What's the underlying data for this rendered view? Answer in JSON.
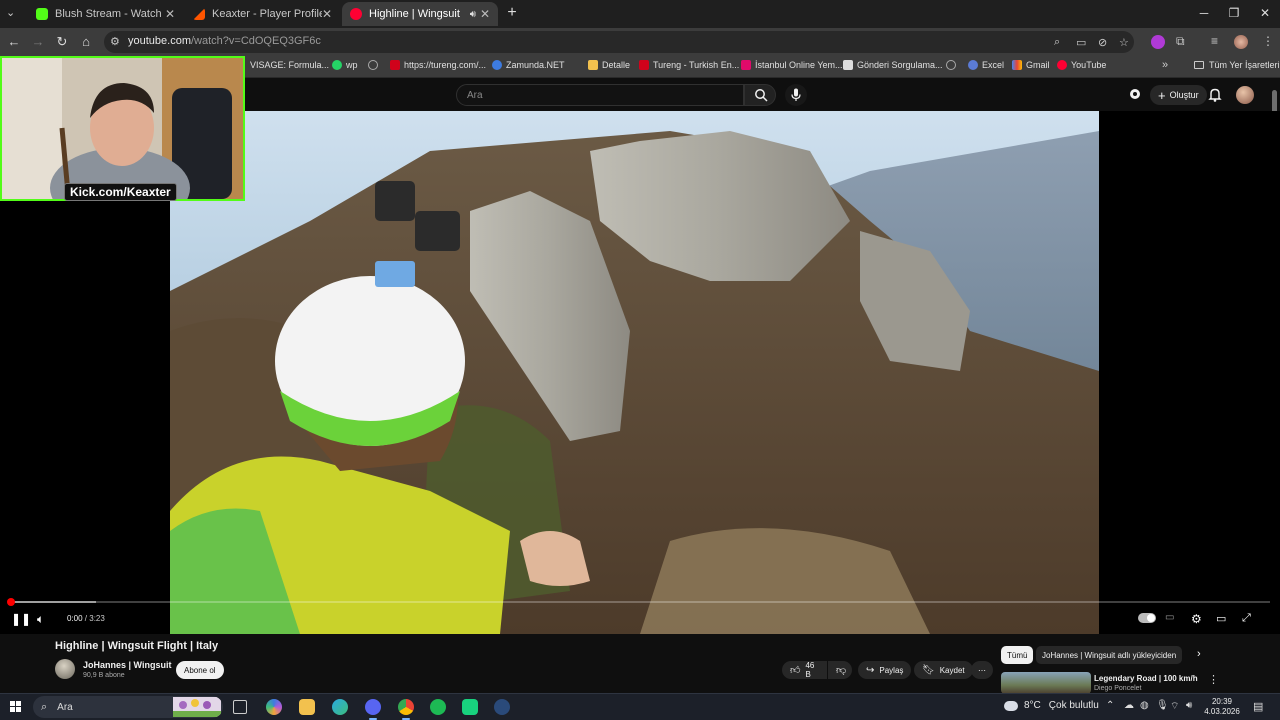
{
  "browser": {
    "tabs": [
      {
        "title": "Blush Stream - Watch Live on K",
        "favicon_color": "#53fc18"
      },
      {
        "title": "Keaxter - Player Profile - FACEIT",
        "favicon_color": "#ff5500"
      },
      {
        "title": "Highline | Wingsuit Flight |",
        "favicon_color": "#ff0033"
      }
    ],
    "url_host": "youtube.com",
    "url_path": "/watch?v=CdOQEQ3GF6c",
    "bookmarks": [
      {
        "label": "VISAGE: Formula...",
        "color": "#888888"
      },
      {
        "label": "wp",
        "color": "#25d366"
      },
      {
        "label": "",
        "color": "#aaaaaa"
      },
      {
        "label": "https://tureng.com/...",
        "color": "#d0021b"
      },
      {
        "label": "Zamunda.NET",
        "color": "#3d7be0"
      },
      {
        "label": "Detalle",
        "color": "#f2c14e"
      },
      {
        "label": "Tureng - Turkish En...",
        "color": "#d0021b"
      },
      {
        "label": "İstanbul Online Yem...",
        "color": "#e00a6a"
      },
      {
        "label": "Gönderi Sorgulama...",
        "color": "#dddddd"
      },
      {
        "label": "",
        "color": "#aaaaaa"
      },
      {
        "label": "Excel",
        "color": "#5b7bd5"
      },
      {
        "label": "Gmail",
        "color": "#ea4335"
      },
      {
        "label": "YouTube",
        "color": "#ff0033"
      }
    ],
    "all_bookmarks": "Tüm Yer İşaretleri"
  },
  "youtube": {
    "search_placeholder": "Ara",
    "create_label": "Oluştur"
  },
  "stream_overlay": {
    "label": "Kick.com/Keaxter"
  },
  "player": {
    "current_time": "0:00",
    "duration": " / 3:23",
    "progress_percent": 0
  },
  "video": {
    "title": "Highline | Wingsuit Flight | Italy",
    "channel": "JoHannes | Wingsuit",
    "subscribers": "90,9 B abone",
    "subscribe_label": "Abone ol",
    "likes": "46 B",
    "share_label": "Paylaş",
    "save_label": "Kaydet"
  },
  "sidebar": {
    "chips": [
      "Tümü",
      "JoHannes | Wingsuit adlı yükleyiciden"
    ],
    "recommended": {
      "title": "Legendary Road | 100 km/h",
      "channel": "Diego Poncelet"
    }
  },
  "taskbar": {
    "search_placeholder": "Ara",
    "temperature": "8°C",
    "weather": "Çok bulutlu",
    "time": "20:39",
    "date": "4.03.2026"
  }
}
